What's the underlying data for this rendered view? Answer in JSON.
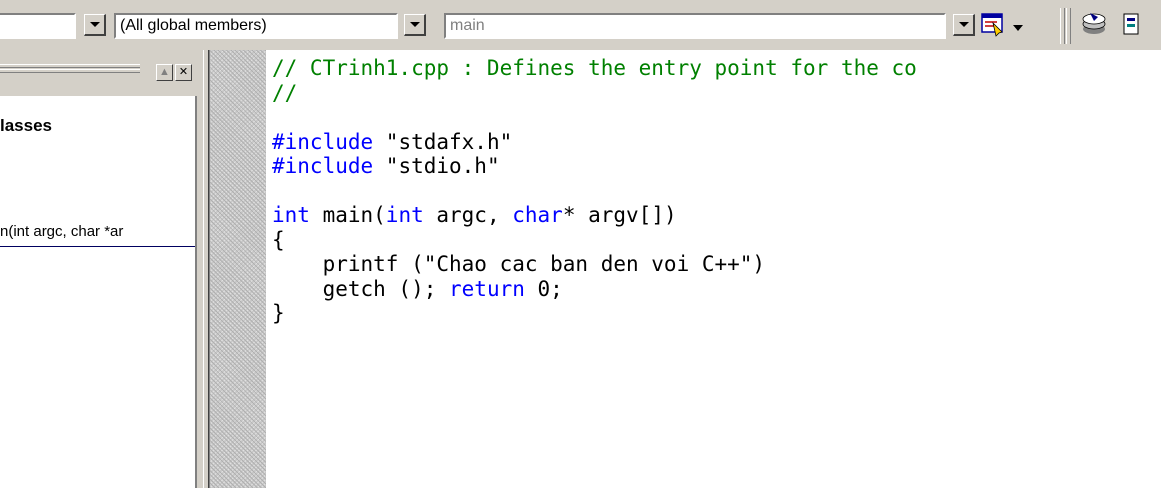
{
  "toolbar": {
    "class_combo_value": "",
    "members_combo_value": "(All global members)",
    "function_combo_value": "main",
    "icons": [
      "dropdown-arrow-icon",
      "wizard-bar-actions-icon",
      "compile-icon"
    ]
  },
  "class_view": {
    "heading": "lasses",
    "tree_item": "n(int argc, char *ar",
    "buttons": [
      "restore-icon",
      "close-icon"
    ]
  },
  "editor": {
    "lines": [
      [
        {
          "t": "// CTrinh1.cpp : Defines the entry point for the co",
          "c": "cm"
        }
      ],
      [
        {
          "t": "//",
          "c": "cm"
        }
      ],
      [
        {
          "t": "",
          "c": ""
        }
      ],
      [
        {
          "t": "#include",
          "c": "kw"
        },
        {
          "t": " \"stdafx.h\"",
          "c": ""
        }
      ],
      [
        {
          "t": "#include",
          "c": "kw"
        },
        {
          "t": " \"stdio.h\"",
          "c": ""
        }
      ],
      [
        {
          "t": "",
          "c": ""
        }
      ],
      [
        {
          "t": "int",
          "c": "kw"
        },
        {
          "t": " main(",
          "c": ""
        },
        {
          "t": "int",
          "c": "kw"
        },
        {
          "t": " argc, ",
          "c": ""
        },
        {
          "t": "char",
          "c": "kw"
        },
        {
          "t": "* argv[])",
          "c": ""
        }
      ],
      [
        {
          "t": "{",
          "c": ""
        }
      ],
      [
        {
          "t": "    printf (\"Chao cac ban den voi C++\")",
          "c": ""
        }
      ],
      [
        {
          "t": "    getch (); ",
          "c": ""
        },
        {
          "t": "return",
          "c": "kw"
        },
        {
          "t": " 0;",
          "c": ""
        }
      ],
      [
        {
          "t": "}",
          "c": ""
        }
      ]
    ]
  },
  "colors": {
    "comment": "#008000",
    "keyword": "#0000ff",
    "chrome": "#d4d0c8"
  }
}
